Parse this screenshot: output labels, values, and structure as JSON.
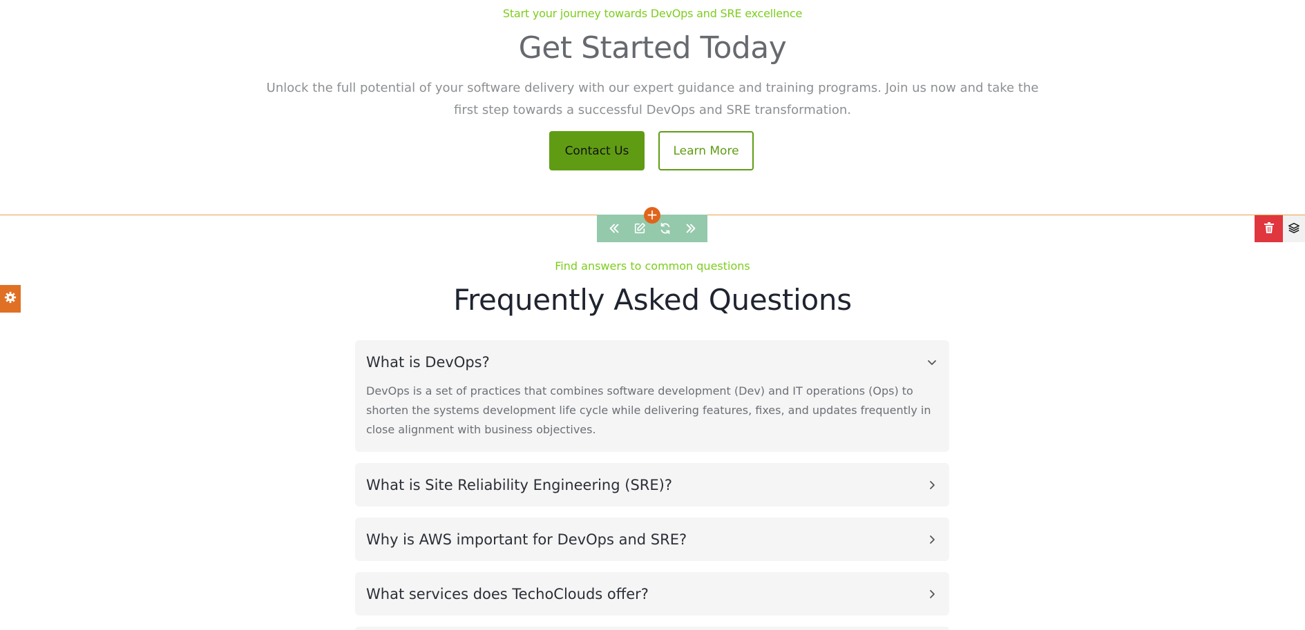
{
  "cta": {
    "eyebrow": "Start your journey towards DevOps and SRE excellence",
    "title": "Get Started Today",
    "description": "Unlock the full potential of your software delivery with our expert guidance and training programs. Join us now and take the first step towards a successful DevOps and SRE transformation.",
    "primary_button": "Contact Us",
    "secondary_button": "Learn More"
  },
  "editor": {
    "add_icon": "plus-icon",
    "toolbar_icons": [
      "move-up-icon",
      "edit-icon",
      "refresh-icon",
      "move-down-icon"
    ],
    "delete_icon": "trash-icon",
    "layers_icon": "layers-icon",
    "settings_icon": "gear-icon",
    "accent_color": "#e0641c",
    "toolbar_color": "#94c9ab",
    "delete_color": "#e0363e"
  },
  "faq": {
    "eyebrow": "Find answers to common questions",
    "title": "Frequently Asked Questions",
    "items": [
      {
        "question": "What is DevOps?",
        "answer": "DevOps is a set of practices that combines software development (Dev) and IT operations (Ops) to shorten the systems development life cycle while delivering features, fixes, and updates frequently in close alignment with business objectives.",
        "open": true
      },
      {
        "question": "What is Site Reliability Engineering (SRE)?",
        "open": false
      },
      {
        "question": "Why is AWS important for DevOps and SRE?",
        "open": false
      },
      {
        "question": "What services does TechoClouds offer?",
        "open": false
      }
    ]
  },
  "colors": {
    "brand_green": "#5f9c13",
    "eyebrow_green": "#7ccd1c"
  }
}
